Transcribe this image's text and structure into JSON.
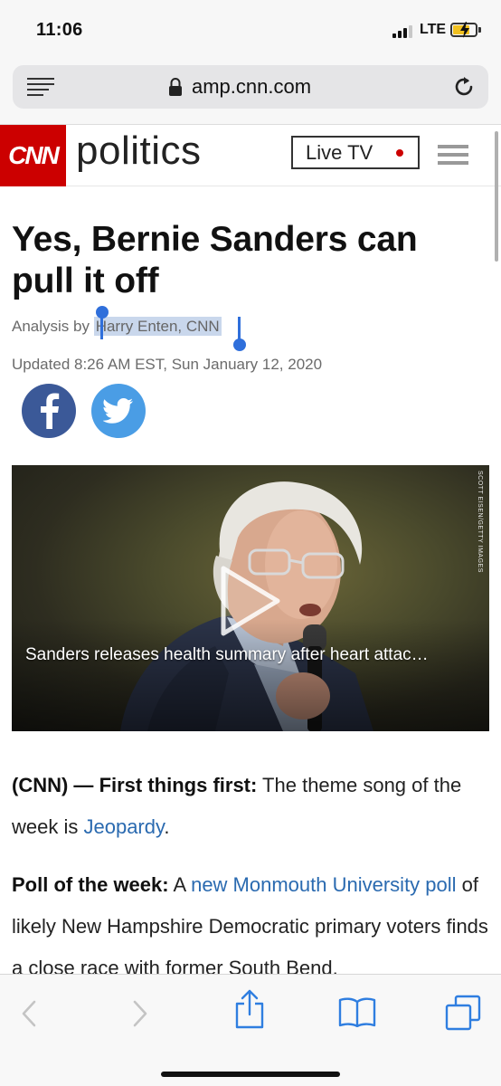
{
  "status_bar": {
    "time": "11:06",
    "network": "LTE",
    "signal_bars_active": 3,
    "signal_bars_total": 4,
    "battery_level": 0.75,
    "battery_color": "#f0c020"
  },
  "browser": {
    "url": "amp.cnn.com",
    "reader_icon": "reader-icon",
    "lock_icon": "lock-icon",
    "reload_icon": "reload-icon"
  },
  "site_header": {
    "logo": "CNN",
    "section": "politics",
    "live_tv_label": "Live TV",
    "brand_color": "#cc0000",
    "menu_icon": "hamburger-menu-icon"
  },
  "article": {
    "headline": "Yes, Bernie Sanders can pull it off",
    "byline_prefix": "Analysis by ",
    "byline_author": "Harry Enten, CNN",
    "updated": "Updated 8:26 AM EST, Sun January 12, 2020",
    "share": {
      "facebook_icon": "facebook-icon",
      "twitter_icon": "twitter-icon",
      "facebook_color": "#3b5998",
      "twitter_color": "#4a9de5"
    },
    "video": {
      "caption": "Sanders releases health summary after heart attac…",
      "credit": "SCOTT EISEN/GETTY IMAGES",
      "play_icon": "play-icon"
    },
    "paragraph1": {
      "dateline": "(CNN) —",
      "lead": "First things first:",
      "text1": " The theme song of the week is ",
      "link": "Jeopardy",
      "text2": "."
    },
    "paragraph2": {
      "lead": "Poll of the week:",
      "text1": " A ",
      "link": "new Monmouth University poll",
      "text2": " of likely New Hampshire Democratic primary voters finds a close race with former South Bend,"
    },
    "link_color": "#2a6ab0"
  },
  "toolbar": {
    "back_icon": "back-arrow-icon",
    "forward_icon": "forward-arrow-icon",
    "share_icon": "share-icon",
    "bookmarks_icon": "bookmarks-icon",
    "tabs_icon": "tabs-icon"
  }
}
